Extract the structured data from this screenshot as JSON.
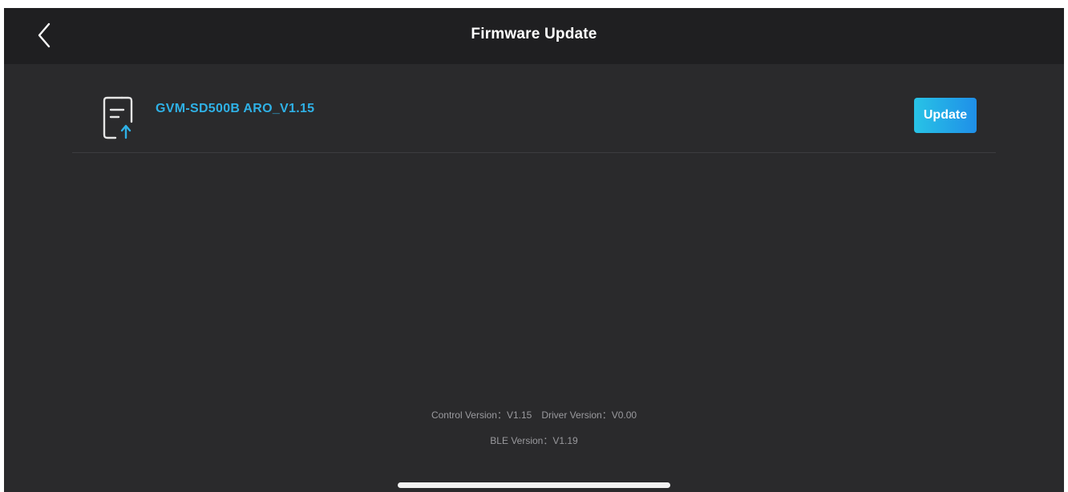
{
  "header": {
    "title": "Firmware Update",
    "back_icon": "chevron-left-icon"
  },
  "firmware": {
    "icon": "file-upload-icon",
    "name": "GVM-SD500B ARO_V1.15",
    "update_label": "Update"
  },
  "versions": {
    "control_label": "Control Version：",
    "control_value": "V1.15",
    "driver_label": "Driver Version：",
    "driver_value": "V0.00",
    "ble_label": "BLE Version：",
    "ble_value": "V1.19"
  },
  "colors": {
    "background": "#2a2a2c",
    "header_background": "#1f1f21",
    "accent": "#2fb1e6",
    "button_gradient_start": "#28c3e6",
    "button_gradient_end": "#1f8fe8",
    "secondary_text": "#9a9a9e"
  }
}
